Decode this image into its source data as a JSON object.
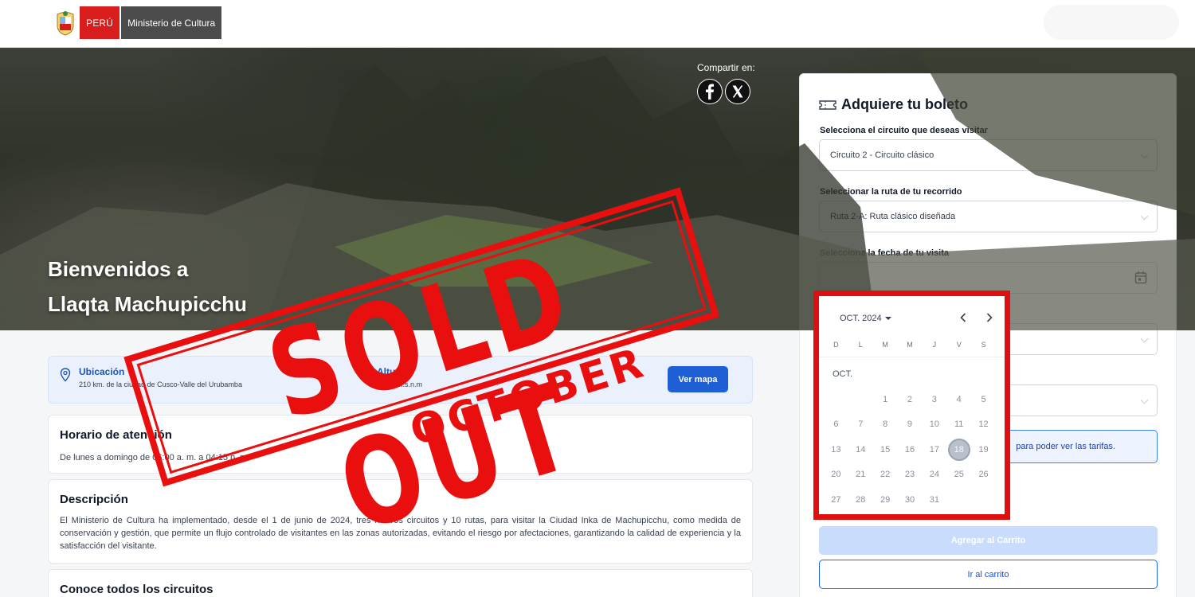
{
  "header": {
    "brand_peru": "PERÚ",
    "brand_ministry": "Ministerio de Cultura"
  },
  "hero": {
    "title_line1": "Bienvenidos a",
    "title_line2": "Llaqta Machupicchu",
    "share_label": "Compartir en:",
    "share_icons": [
      "facebook-icon",
      "x-icon"
    ]
  },
  "info": {
    "location_label": "Ubicación",
    "location_value": "210 km. de la ciudad de Cusco-Valle del Urubamba",
    "altitude_label": "Altura",
    "altitude_value": "2,430 m.s.n.m",
    "map_button": "Ver mapa"
  },
  "schedule": {
    "title": "Horario de atención",
    "text": "De lunes a domingo de 06:00 a. m. a 04:15 p. m."
  },
  "description": {
    "title": "Descripción",
    "text": "El Ministerio de Cultura ha implementado, desde el 1 de junio de 2024, tres nuevos circuitos y 10 rutas, para visitar la Ciudad Inka de Machupicchu, como medida de conservación y gestión, que permite un flujo controlado de visitantes en las zonas autorizadas, evitando el riesgo por afectaciones, garantizando la calidad de experiencia y la satisfacción del visitante."
  },
  "circuits": {
    "title": "Conoce todos los circuitos"
  },
  "ticket": {
    "title": "Adquiere tu boleto",
    "circuit_label": "Selecciona el circuito que deseas visitar",
    "circuit_value": "Circuito 2 - Circuito clásico",
    "route_label": "Seleccionar la ruta de tu recorrido",
    "route_value": "Ruta 2-A: Ruta clásico diseñada",
    "date_label": "Selecciona la fecha de tu visita",
    "date_value": "",
    "hint": "para poder ver las tarifas.",
    "add_to_cart": "Agregar al Carrito",
    "go_to_cart": "Ir al carrito"
  },
  "calendar": {
    "month_label": "OCT. 2024",
    "month_short": "OCT.",
    "weekdays": [
      "D",
      "L",
      "M",
      "M",
      "J",
      "V",
      "S"
    ],
    "first_weekday_index": 2,
    "days_in_month": 31,
    "selected_day": 18
  },
  "stamp": {
    "main": "SOLD OUT",
    "sub": "OCTOBER",
    "color": "#ea0f0f"
  },
  "colors": {
    "accent": "#1f5fd6",
    "highlight": "#e00e0e"
  }
}
